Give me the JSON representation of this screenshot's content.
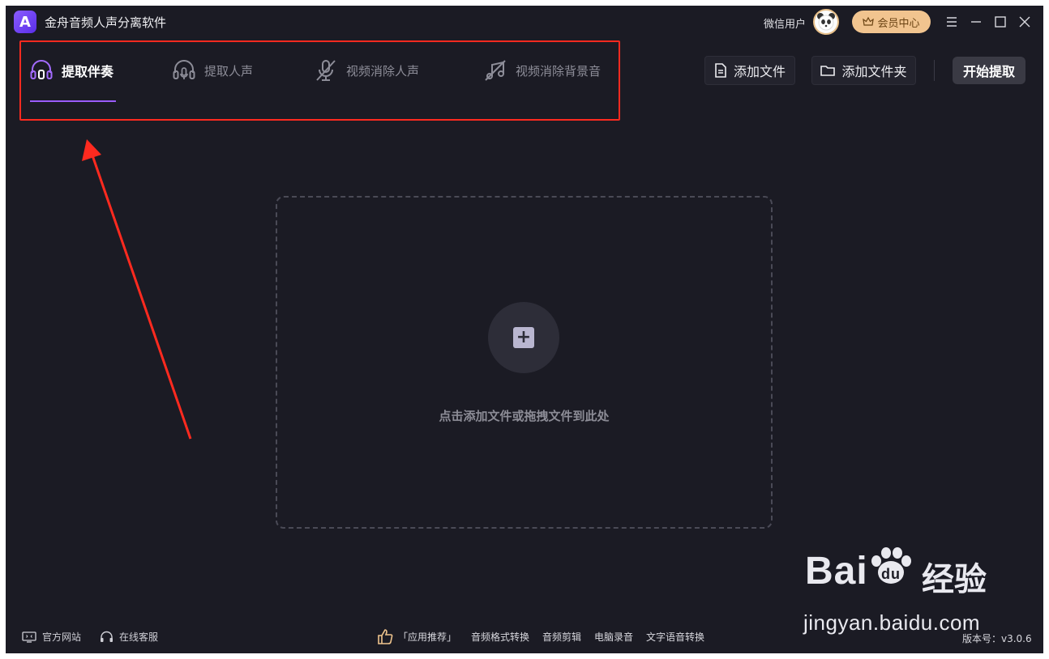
{
  "app": {
    "title": "金舟音频人声分离软件",
    "logo_letter": "A",
    "user_label": "微信用户",
    "member_label": "会员中心"
  },
  "tabs": [
    {
      "label": "提取伴奏",
      "active": true,
      "icon": "headphones-icon"
    },
    {
      "label": "提取人声",
      "active": false,
      "icon": "headphones-mic-icon"
    },
    {
      "label": "视频消除人声",
      "active": false,
      "icon": "mic-off-icon"
    },
    {
      "label": "视频消除背景音",
      "active": false,
      "icon": "music-off-icon"
    }
  ],
  "actions": {
    "add_file": "添加文件",
    "add_folder": "添加文件夹",
    "start": "开始提取"
  },
  "dropzone": {
    "hint": "点击添加文件或拖拽文件到此处"
  },
  "footer": {
    "official_site": "官方网站",
    "online_service": "在线客服",
    "recommend_label": "「应用推荐」",
    "recommend_items": [
      "音频格式转换",
      "音频剪辑",
      "电脑录音",
      "文字语音转换"
    ],
    "version": "版本号：v3.0.6"
  },
  "watermark": {
    "brand": "Bai",
    "brand_suffix": "经验",
    "url": "jingyan.baidu.com"
  },
  "colors": {
    "background": "#1b1b24",
    "accent": "#9b5cff",
    "highlight_box": "#ff2a1f",
    "member_bg": "#f1c48f"
  }
}
